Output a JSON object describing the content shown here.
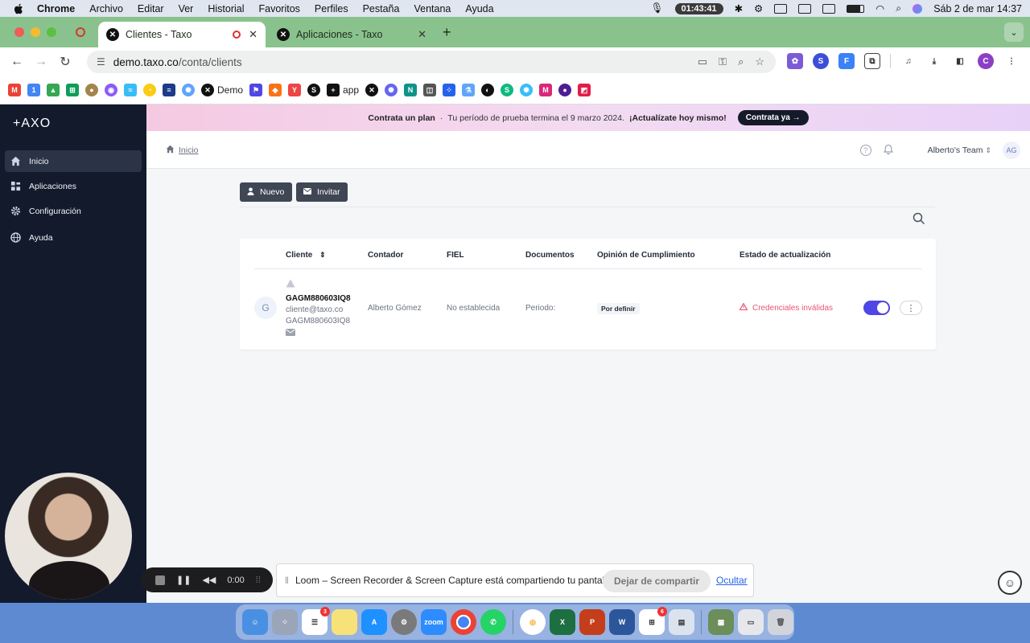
{
  "menubar": {
    "app": "Chrome",
    "items": [
      "Archivo",
      "Editar",
      "Ver",
      "Historial",
      "Favoritos",
      "Perfiles",
      "Pestaña",
      "Ventana",
      "Ayuda"
    ],
    "timer": "01:43:41",
    "datetime": "Sáb 2 de mar  14:37"
  },
  "browser": {
    "tabs": [
      {
        "title": "Clientes - Taxo",
        "active": true
      },
      {
        "title": "Aplicaciones - Taxo",
        "active": false
      }
    ],
    "url_host": "demo.taxo.co",
    "url_path": "/conta/clients",
    "bookmarks": [
      {
        "label": "Demo",
        "icon": "x-logo-icon"
      },
      {
        "label": "app",
        "icon": "plus-icon"
      }
    ]
  },
  "sidebar": {
    "logo": "+AXO",
    "items": [
      {
        "label": "Inicio",
        "icon": "home-icon",
        "active": true
      },
      {
        "label": "Aplicaciones",
        "icon": "apps-icon",
        "active": false
      },
      {
        "label": "Configuración",
        "icon": "gear-icon",
        "active": false
      },
      {
        "label": "Ayuda",
        "icon": "globe-icon",
        "active": false
      }
    ]
  },
  "banner": {
    "lead": "Contrata un plan",
    "sep": "·",
    "text": "Tu período de prueba termina el 9 marzo 2024.",
    "emph": "¡Actualízate hoy mismo!",
    "cta": "Contrata ya →"
  },
  "topbar": {
    "breadcrumb": "Inicio",
    "team": "Alberto's Team",
    "avatar": "AG"
  },
  "actions": {
    "new_label": "Nuevo",
    "invite_label": "Invitar"
  },
  "table": {
    "headers": [
      "Cliente",
      "Contador",
      "FIEL",
      "Documentos",
      "Opinión de Cumplimiento",
      "Estado de actualización"
    ],
    "rows": [
      {
        "avatar": "G",
        "rfc": "GAGM880603IQ8",
        "email": "cliente@taxo.co",
        "rfc2": "GAGM880603IQ8",
        "contador": "Alberto Gómez",
        "fiel": "No establecida",
        "documentos": "Periodo:",
        "opinion": "Por definir",
        "estado": "Credenciales inválidas",
        "enabled": true
      }
    ]
  },
  "loom": {
    "time": "0:00",
    "message": "Loom – Screen Recorder & Screen Capture está compartiendo tu pantalla.",
    "stop_label": "Dejar de compartir",
    "hide_label": "Ocultar"
  },
  "dock": {
    "reminders_badge": "3",
    "apps_badge": "6"
  },
  "colors": {
    "sidebar": "#121a2c",
    "accent": "#4f46e5",
    "error": "#e8567a",
    "chrome_frame": "#8ac28e"
  }
}
